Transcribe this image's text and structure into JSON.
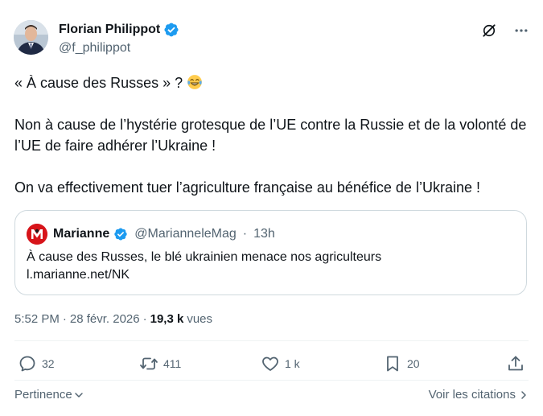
{
  "author": {
    "name": "Florian Philippot",
    "handle": "@f_philippot",
    "verified_color": "#1d9bf0"
  },
  "tweet": {
    "line1": "« À cause des Russes » ?",
    "line1_emoji": "face-with-tears-of-joy",
    "line2": "Non à cause de l’hystérie grotesque de l’UE contre la Russie et de la volonté de l’UE de faire adhérer l’Ukraine !",
    "line3": "On va effectivement tuer l’agriculture française au bénéfice de l’Ukraine !"
  },
  "quote": {
    "name": "Marianne",
    "handle": "@MarianneleMag",
    "separator": "·",
    "time": "13h",
    "text": "À cause des Russes, le blé ukrainien menace nos agriculteurs",
    "link": "l.marianne.net/NK"
  },
  "meta": {
    "time": "5:52 PM",
    "separator1": "·",
    "date": "28 févr. 2026",
    "separator2": "·",
    "views_count": "19,3 k",
    "views_label": "vues"
  },
  "actions": {
    "replies": "32",
    "reposts": "411",
    "likes": "1 k",
    "bookmarks": "20"
  },
  "footer": {
    "sort_label": "Pertinence",
    "citations_label": "Voir les citations"
  },
  "colors": {
    "text": "#0f1419",
    "secondary": "#536471",
    "border": "#cfd9de",
    "brand_blue": "#1d9bf0",
    "marianne_red": "#d7141a"
  }
}
